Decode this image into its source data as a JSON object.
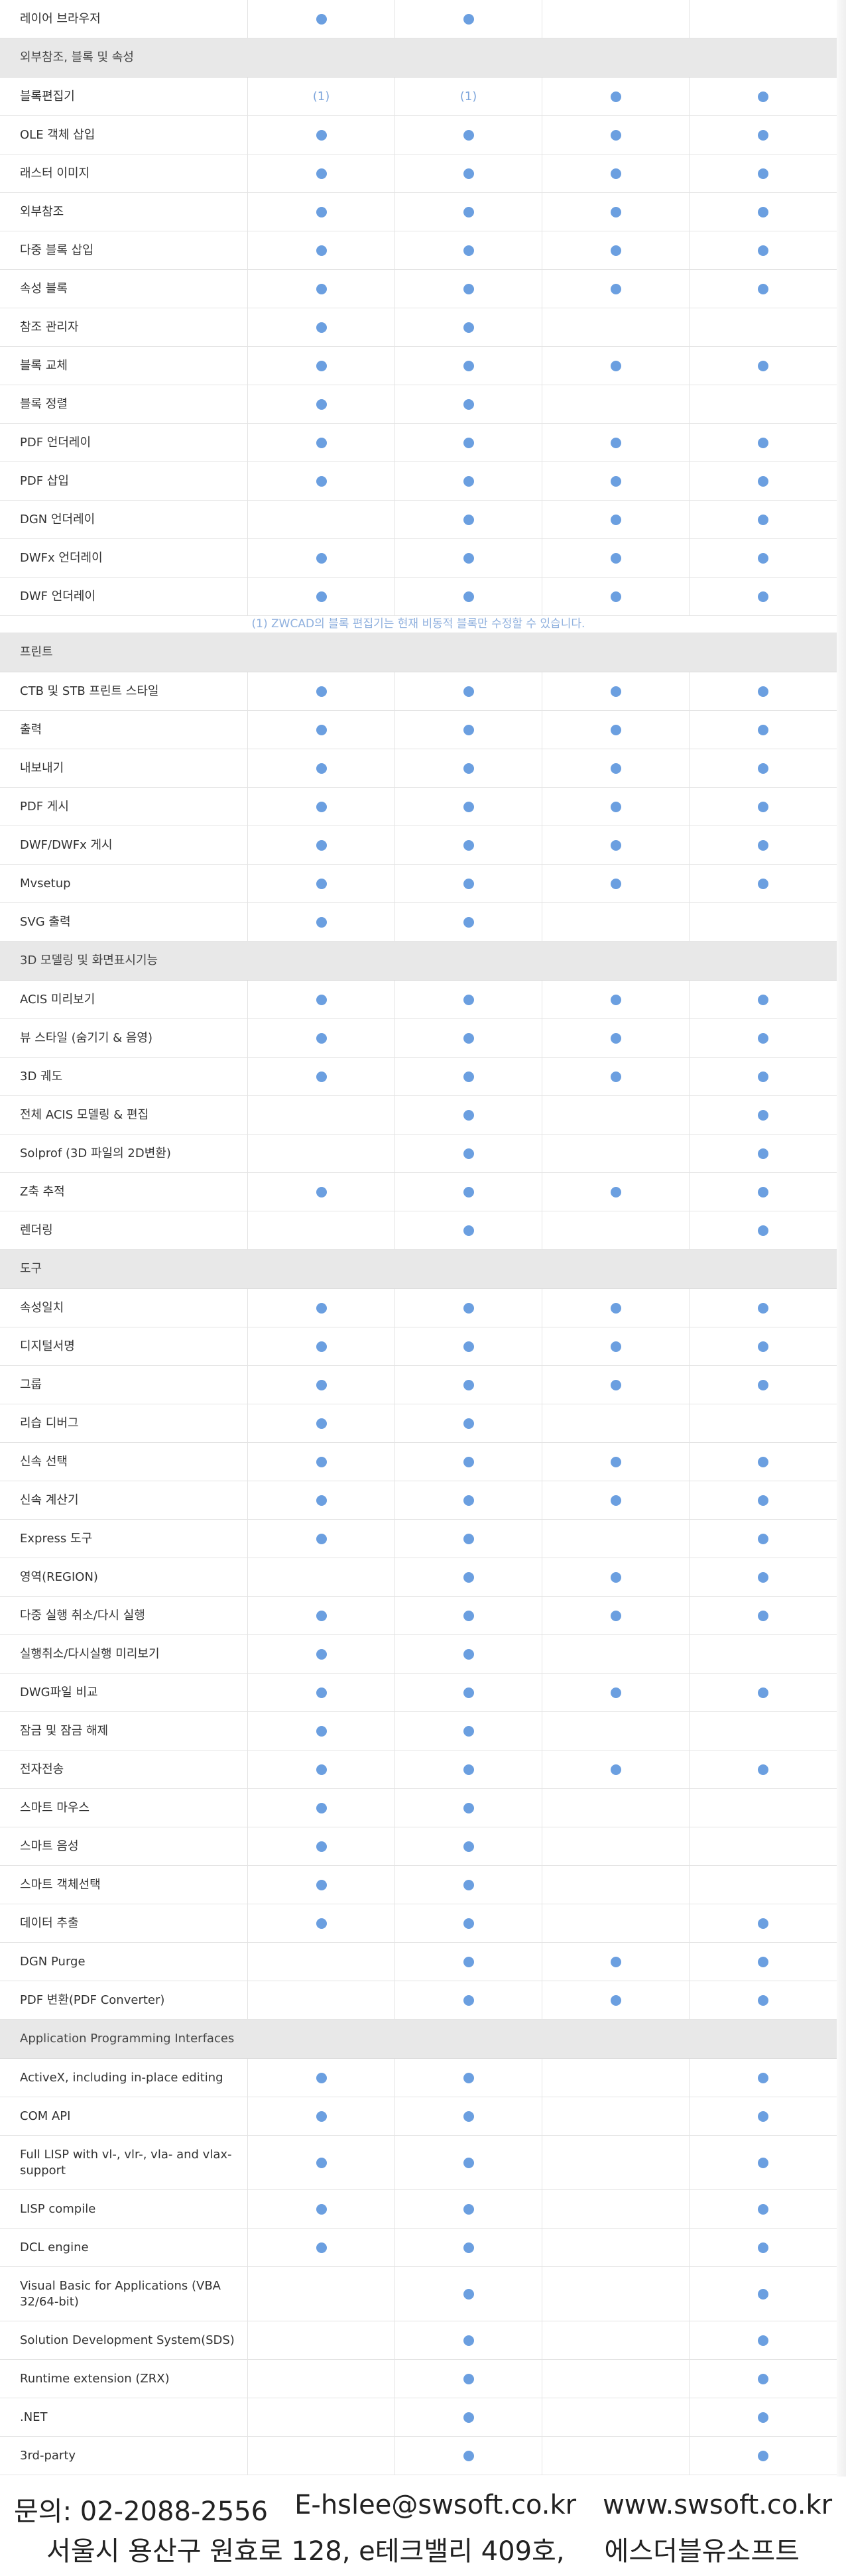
{
  "rows": [
    {
      "type": "row",
      "name": "레이어 브라우저",
      "cols": [
        "dot",
        "dot",
        "",
        ""
      ]
    },
    {
      "type": "section",
      "name": "외부참조, 블록 및 속성"
    },
    {
      "type": "row",
      "name": "블록편집기",
      "cols": [
        "(1)",
        "(1)",
        "dot",
        "dot"
      ]
    },
    {
      "type": "row",
      "name": "OLE 객체 삽입",
      "cols": [
        "dot",
        "dot",
        "dot",
        "dot"
      ]
    },
    {
      "type": "row",
      "name": "래스터 이미지",
      "cols": [
        "dot",
        "dot",
        "dot",
        "dot"
      ]
    },
    {
      "type": "row",
      "name": "외부참조",
      "cols": [
        "dot",
        "dot",
        "dot",
        "dot"
      ]
    },
    {
      "type": "row",
      "name": "다중 블록 삽입",
      "cols": [
        "dot",
        "dot",
        "dot",
        "dot"
      ]
    },
    {
      "type": "row",
      "name": "속성 블록",
      "cols": [
        "dot",
        "dot",
        "dot",
        "dot"
      ]
    },
    {
      "type": "row",
      "name": "참조 관리자",
      "cols": [
        "dot",
        "dot",
        "",
        ""
      ]
    },
    {
      "type": "row",
      "name": "블록 교체",
      "cols": [
        "dot",
        "dot",
        "dot",
        "dot"
      ]
    },
    {
      "type": "row",
      "name": "블록 정렬",
      "cols": [
        "dot",
        "dot",
        "",
        ""
      ]
    },
    {
      "type": "row",
      "name": "PDF 언더레이",
      "cols": [
        "dot",
        "dot",
        "dot",
        "dot"
      ]
    },
    {
      "type": "row",
      "name": "PDF 삽입",
      "cols": [
        "dot",
        "dot",
        "dot",
        "dot"
      ]
    },
    {
      "type": "row",
      "name": "DGN 언더레이",
      "cols": [
        "",
        "dot",
        "dot",
        "dot"
      ]
    },
    {
      "type": "row",
      "name": "DWFx 언더레이",
      "cols": [
        "dot",
        "dot",
        "dot",
        "dot"
      ]
    },
    {
      "type": "row",
      "name": "DWF 언더레이",
      "cols": [
        "dot",
        "dot",
        "dot",
        "dot"
      ]
    },
    {
      "type": "note",
      "text": "(1) ZWCAD의 블록 편집기는 현재 비동적 블록만 수정할 수 있습니다."
    },
    {
      "type": "section",
      "name": "프린트"
    },
    {
      "type": "row",
      "name": "CTB 및 STB 프린트 스타일",
      "cols": [
        "dot",
        "dot",
        "dot",
        "dot"
      ]
    },
    {
      "type": "row",
      "name": "출력",
      "cols": [
        "dot",
        "dot",
        "dot",
        "dot"
      ]
    },
    {
      "type": "row",
      "name": "내보내기",
      "cols": [
        "dot",
        "dot",
        "dot",
        "dot"
      ]
    },
    {
      "type": "row",
      "name": "PDF 게시",
      "cols": [
        "dot",
        "dot",
        "dot",
        "dot"
      ]
    },
    {
      "type": "row",
      "name": "DWF/DWFx 게시",
      "cols": [
        "dot",
        "dot",
        "dot",
        "dot"
      ]
    },
    {
      "type": "row",
      "name": "Mvsetup",
      "cols": [
        "dot",
        "dot",
        "dot",
        "dot"
      ]
    },
    {
      "type": "row",
      "name": "SVG 출력",
      "cols": [
        "dot",
        "dot",
        "",
        ""
      ]
    },
    {
      "type": "section",
      "name": "3D 모델링 및 화면표시기능"
    },
    {
      "type": "row",
      "name": "ACIS 미리보기",
      "cols": [
        "dot",
        "dot",
        "dot",
        "dot"
      ]
    },
    {
      "type": "row",
      "name": "뷰 스타일 (숨기기 & 음영)",
      "cols": [
        "dot",
        "dot",
        "dot",
        "dot"
      ]
    },
    {
      "type": "row",
      "name": "3D 궤도",
      "cols": [
        "dot",
        "dot",
        "dot",
        "dot"
      ]
    },
    {
      "type": "row",
      "name": "전체 ACIS 모델링 & 편집",
      "cols": [
        "",
        "dot",
        "",
        "dot"
      ]
    },
    {
      "type": "row",
      "name": "Solprof (3D 파일의 2D변환)",
      "cols": [
        "",
        "dot",
        "",
        "dot"
      ]
    },
    {
      "type": "row",
      "name": "Z축 추적",
      "cols": [
        "dot",
        "dot",
        "dot",
        "dot"
      ]
    },
    {
      "type": "row",
      "name": "렌더링",
      "cols": [
        "",
        "dot",
        "",
        "dot"
      ]
    },
    {
      "type": "section",
      "name": "도구"
    },
    {
      "type": "row",
      "name": "속성일치",
      "cols": [
        "dot",
        "dot",
        "dot",
        "dot"
      ]
    },
    {
      "type": "row",
      "name": "디지털서명",
      "cols": [
        "dot",
        "dot",
        "dot",
        "dot"
      ]
    },
    {
      "type": "row",
      "name": "그룹",
      "cols": [
        "dot",
        "dot",
        "dot",
        "dot"
      ]
    },
    {
      "type": "row",
      "name": "리습 디버그",
      "cols": [
        "dot",
        "dot",
        "",
        ""
      ]
    },
    {
      "type": "row",
      "name": "신속 선택",
      "cols": [
        "dot",
        "dot",
        "dot",
        "dot"
      ]
    },
    {
      "type": "row",
      "name": "신속 계산기",
      "cols": [
        "dot",
        "dot",
        "dot",
        "dot"
      ]
    },
    {
      "type": "row",
      "name": "Express 도구",
      "cols": [
        "dot",
        "dot",
        "",
        "dot"
      ]
    },
    {
      "type": "row",
      "name": "영역(REGION)",
      "cols": [
        "",
        "dot",
        "dot",
        "dot"
      ]
    },
    {
      "type": "row",
      "name": "다중 실행 취소/다시 실행",
      "cols": [
        "dot",
        "dot",
        "dot",
        "dot"
      ]
    },
    {
      "type": "row",
      "name": "실행취소/다시실행 미리보기",
      "cols": [
        "dot",
        "dot",
        "",
        ""
      ]
    },
    {
      "type": "row",
      "name": "DWG파일 비교",
      "cols": [
        "dot",
        "dot",
        "dot",
        "dot"
      ]
    },
    {
      "type": "row",
      "name": "잠금 및 잠금 해제",
      "cols": [
        "dot",
        "dot",
        "",
        ""
      ]
    },
    {
      "type": "row",
      "name": "전자전송",
      "cols": [
        "dot",
        "dot",
        "dot",
        "dot"
      ]
    },
    {
      "type": "row",
      "name": "스마트 마우스",
      "cols": [
        "dot",
        "dot",
        "",
        ""
      ]
    },
    {
      "type": "row",
      "name": "스마트 음성",
      "cols": [
        "dot",
        "dot",
        "",
        ""
      ]
    },
    {
      "type": "row",
      "name": "스마트 객체선택",
      "cols": [
        "dot",
        "dot",
        "",
        ""
      ]
    },
    {
      "type": "row",
      "name": "데이터 추출",
      "cols": [
        "dot",
        "dot",
        "",
        "dot"
      ]
    },
    {
      "type": "row",
      "name": "DGN Purge",
      "cols": [
        "",
        "dot",
        "dot",
        "dot"
      ]
    },
    {
      "type": "row",
      "name": "PDF 변환(PDF Converter)",
      "cols": [
        "",
        "dot",
        "dot",
        "dot"
      ]
    },
    {
      "type": "section",
      "name": "Application Programming Interfaces"
    },
    {
      "type": "row",
      "name": "ActiveX, including in-place editing",
      "cols": [
        "dot",
        "dot",
        "",
        "dot"
      ]
    },
    {
      "type": "row",
      "name": "COM API",
      "cols": [
        "dot",
        "dot",
        "",
        "dot"
      ]
    },
    {
      "type": "row",
      "tall": true,
      "name": "Full LISP with vl-, vlr-, vla- and vlax-support",
      "cols": [
        "dot",
        "dot",
        "",
        "dot"
      ]
    },
    {
      "type": "row",
      "name": "LISP compile",
      "cols": [
        "dot",
        "dot",
        "",
        "dot"
      ]
    },
    {
      "type": "row",
      "name": "DCL engine",
      "cols": [
        "dot",
        "dot",
        "",
        "dot"
      ]
    },
    {
      "type": "row",
      "tall": true,
      "name": "Visual Basic for Applications (VBA 32/64-bit)",
      "cols": [
        "",
        "dot",
        "",
        "dot"
      ]
    },
    {
      "type": "row",
      "name": "Solution Development System(SDS)",
      "cols": [
        "",
        "dot",
        "",
        "dot"
      ]
    },
    {
      "type": "row",
      "name": "Runtime extension (ZRX)",
      "cols": [
        "",
        "dot",
        "",
        "dot"
      ]
    },
    {
      "type": "row",
      "name": ".NET",
      "cols": [
        "",
        "dot",
        "",
        "dot"
      ]
    },
    {
      "type": "row",
      "name": "3rd-party",
      "cols": [
        "",
        "dot",
        "",
        "dot"
      ]
    }
  ],
  "footer": {
    "contact_label": "문의: 02-2088-2556",
    "email": "E-hslee@swsoft.co.kr",
    "website": "www.swsoft.co.kr",
    "address": "서울시 용산구 원효로 128, e테크밸리 409호,",
    "company": "에스더블유소프트"
  },
  "colors": {
    "dot": "#6b9fe0",
    "section_bg": "#e8e8e8",
    "note_text": "#8fb0de"
  }
}
